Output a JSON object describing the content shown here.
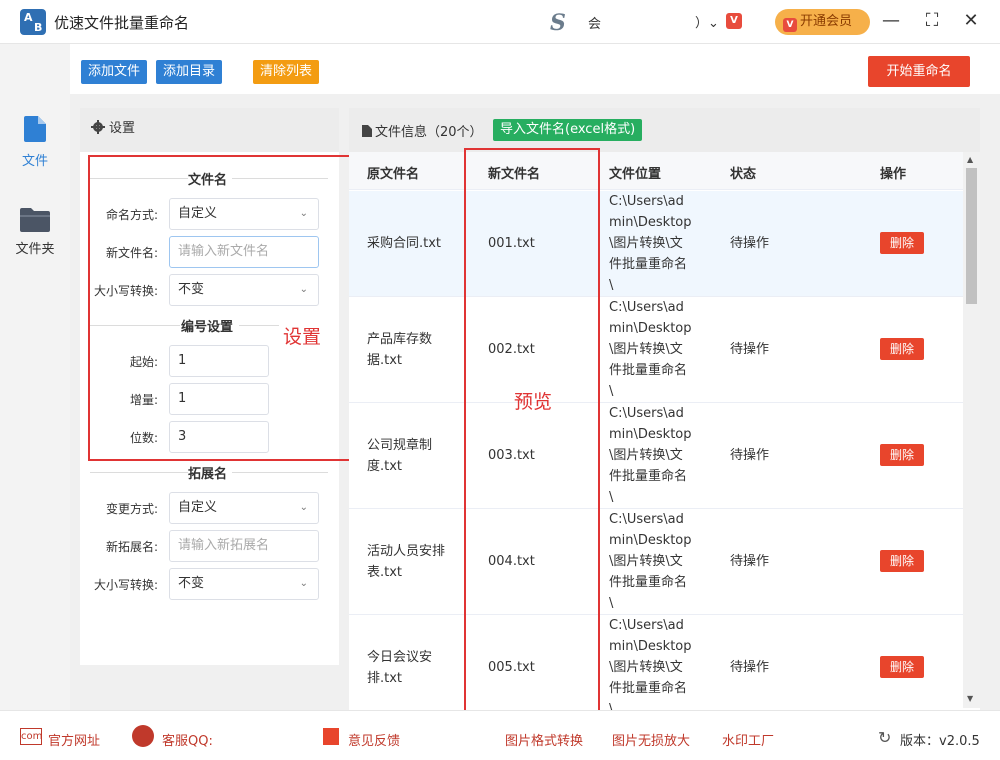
{
  "app": {
    "title": "优速文件批量重命名",
    "logo_text": "AB",
    "header_text": "会",
    "header_misc": "）⌄"
  },
  "colors": {
    "accent": "#2f80d4",
    "danger": "#e8452c",
    "orange": "#f39c12",
    "green": "#27ae60"
  },
  "header": {
    "vip_label": "开通会员",
    "minimize": "—",
    "maximize": "⛶",
    "close": "✕",
    "vip_icon": "V"
  },
  "toolbar": {
    "add_file": "添加文件",
    "add_dir": "添加目录",
    "clear_list": "清除列表",
    "start": "开始重命名"
  },
  "sidebar": {
    "items": [
      {
        "label": "文件",
        "icon": "file-icon"
      },
      {
        "label": "文件夹",
        "icon": "folder-icon"
      }
    ]
  },
  "settings": {
    "title": "设置",
    "filename_section": "文件名",
    "naming_label": "命名方式:",
    "naming_value": "自定义",
    "newname_label": "新文件名:",
    "newname_placeholder": "请输入新文件名",
    "case_label": "大小写转换:",
    "case_value": "不变",
    "number_section": "编号设置",
    "start_label": "起始:",
    "start_value": "1",
    "step_label": "增量:",
    "step_value": "1",
    "digits_label": "位数:",
    "digits_value": "3",
    "ext_section": "拓展名",
    "ext_mode_label": "变更方式:",
    "ext_mode_value": "自定义",
    "ext_new_label": "新拓展名:",
    "ext_new_placeholder": "请输入新拓展名",
    "ext_case_label": "大小写转换:",
    "ext_case_value": "不变"
  },
  "annotations": {
    "settings": "设置",
    "preview": "预览"
  },
  "files": {
    "title": "文件信息（20个）",
    "import_btn": "导入文件名(excel格式)",
    "columns": [
      "原文件名",
      "新文件名",
      "文件位置",
      "状态",
      "操作"
    ],
    "rows": [
      {
        "orig1": "采购合同.txt",
        "orig2": "",
        "new": "001.txt",
        "path": [
          "C:\\Users\\ad",
          "min\\Desktop",
          "\\图片转换\\文",
          "件批量重命名",
          "\\"
        ],
        "status": "待操作",
        "action": "删除"
      },
      {
        "orig1": "产品库存数",
        "orig2": "据.txt",
        "new": "002.txt",
        "path": [
          "C:\\Users\\ad",
          "min\\Desktop",
          "\\图片转换\\文",
          "件批量重命名",
          "\\"
        ],
        "status": "待操作",
        "action": "删除"
      },
      {
        "orig1": "公司规章制",
        "orig2": "度.txt",
        "new": "003.txt",
        "path": [
          "C:\\Users\\ad",
          "min\\Desktop",
          "\\图片转换\\文",
          "件批量重命名",
          "\\"
        ],
        "status": "待操作",
        "action": "删除"
      },
      {
        "orig1": "活动人员安排",
        "orig2": "表.txt",
        "new": "004.txt",
        "path": [
          "C:\\Users\\ad",
          "min\\Desktop",
          "\\图片转换\\文",
          "件批量重命名",
          "\\"
        ],
        "status": "待操作",
        "action": "删除"
      },
      {
        "orig1": "今日会议安",
        "orig2": "排.txt",
        "new": "005.txt",
        "path": [
          "C:\\Users\\ad",
          "min\\Desktop",
          "\\图片转换\\文",
          "件批量重命名",
          "\\"
        ],
        "status": "待操作",
        "action": "删除"
      }
    ]
  },
  "footer": {
    "website": "官方网址",
    "qq": "客服QQ:",
    "feedback": "意见反馈",
    "link1": "图片格式转换",
    "link2": "图片无损放大",
    "link3": "水印工厂",
    "version": "版本：v2.0.5"
  }
}
